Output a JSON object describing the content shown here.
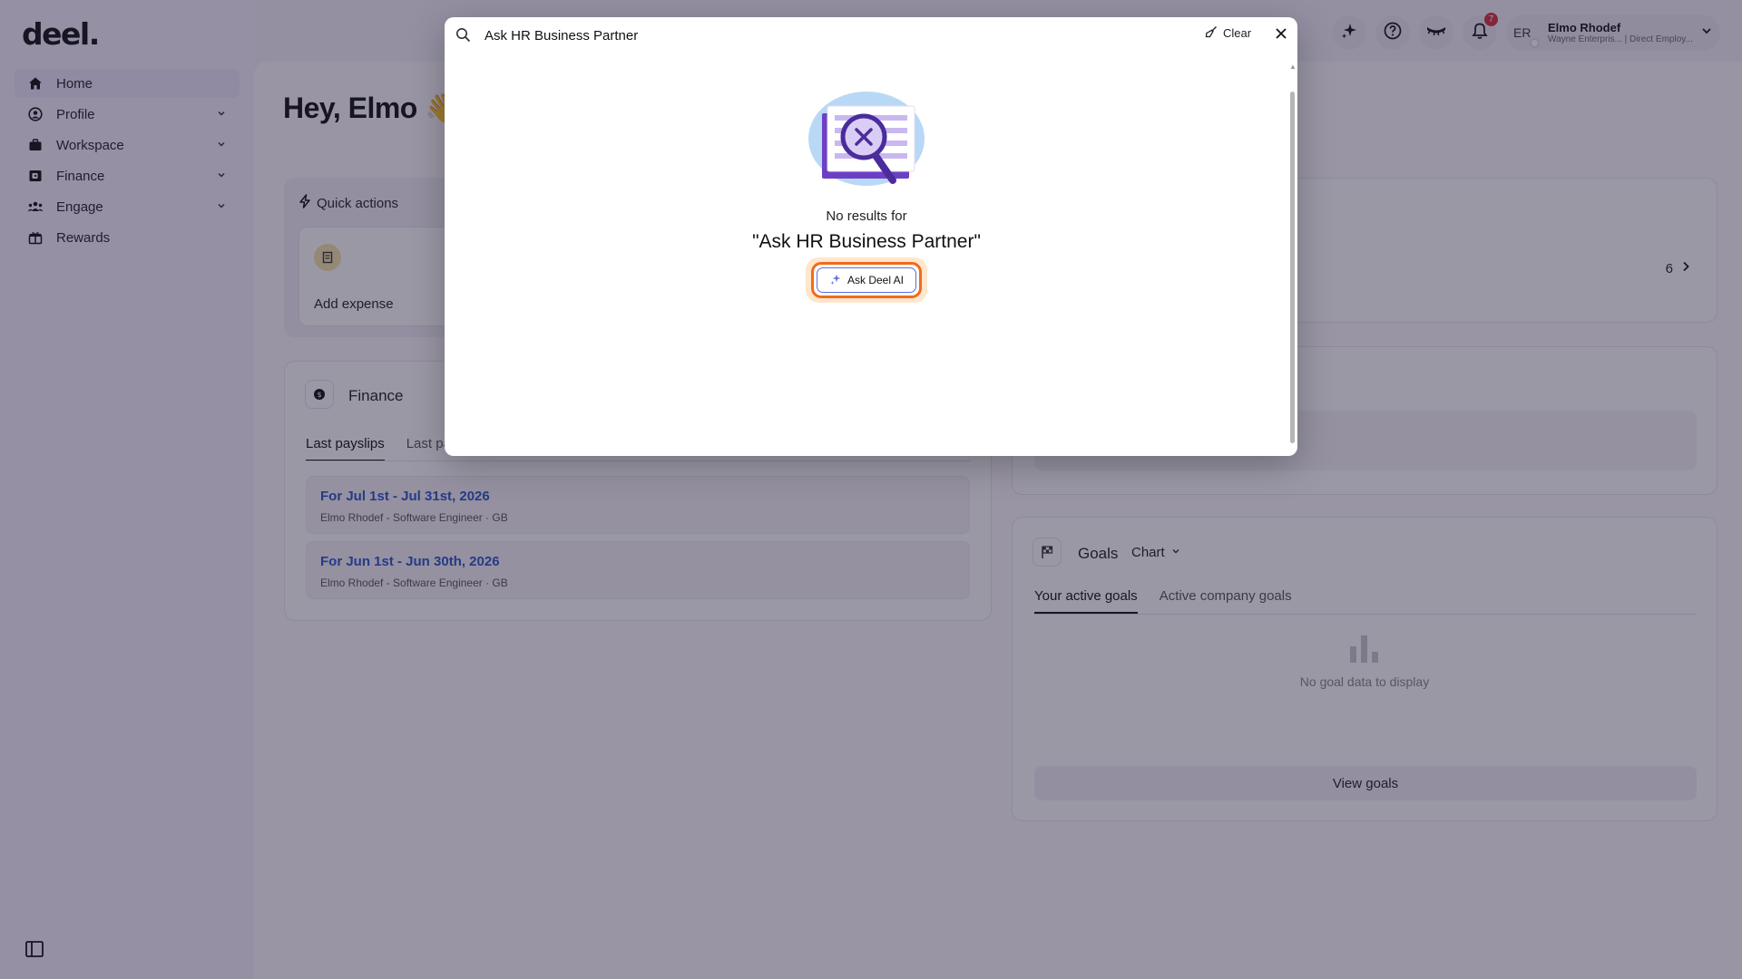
{
  "app": {
    "logo": "deel."
  },
  "sidebar": {
    "items": [
      {
        "label": "Home",
        "icon": "home-icon",
        "active": true
      },
      {
        "label": "Profile",
        "icon": "user-circle-icon"
      },
      {
        "label": "Workspace",
        "icon": "briefcase-icon"
      },
      {
        "label": "Finance",
        "icon": "wallet-icon"
      },
      {
        "label": "Engage",
        "icon": "people-icon"
      },
      {
        "label": "Rewards",
        "icon": "gift-icon"
      }
    ]
  },
  "topbar": {
    "notification_count": "7",
    "user": {
      "initials": "ER",
      "name": "Elmo Rhodef",
      "subtitle": "Wayne Enterpris... | Direct Employ..."
    }
  },
  "main": {
    "greeting": "Hey, Elmo 👋",
    "quick_actions": {
      "title": "Quick actions",
      "items": [
        {
          "label": "Add expense"
        }
      ]
    },
    "finance": {
      "title": "Finance",
      "tabs": [
        "Last payslips",
        "Last pa"
      ],
      "payslips": [
        {
          "title": "For Jul 1st - Jul 31st, 2026",
          "sub": "Elmo Rhodef - Software Engineer · GB"
        },
        {
          "title": "For Jun 1st - Jun 30th, 2026",
          "sub": "Elmo Rhodef - Software Engineer · GB"
        }
      ]
    },
    "right_card": {
      "count": "6"
    },
    "goals": {
      "title": "Goals",
      "view_mode": "Chart",
      "tabs": [
        "Your active goals",
        "Active company goals"
      ],
      "empty_text": "No goal data to display",
      "view_button": "View goals"
    }
  },
  "search_modal": {
    "query": "Ask HR Business Partner",
    "clear_label": "Clear",
    "no_results_label": "No results for",
    "query_display": "\"Ask HR Business Partner\"",
    "ask_ai_label": "Ask Deel AI"
  },
  "colors": {
    "accent_orange": "#f26a1b",
    "link_blue": "#2b54c6",
    "overlay": "#221a3a"
  }
}
